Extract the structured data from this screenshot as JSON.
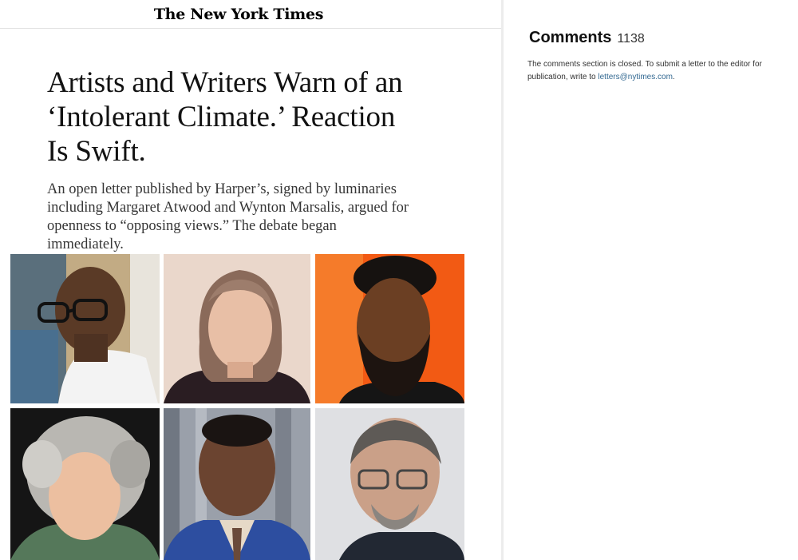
{
  "masthead": {
    "logo_text": "The New York Times"
  },
  "article": {
    "headline": "Artists and Writers Warn of an ‘Intolerant Climate.’ Reaction Is Swift.",
    "summary": "An open letter published by Harper’s, signed by luminaries including Margaret Atwood and Wynton Marsalis, argued for openness to “opposing views.” The debate began immediately.",
    "photos": [
      {
        "icon": "portrait-man-glasses-white-shirt",
        "background": "#c9b48e"
      },
      {
        "icon": "portrait-woman-gray-hair",
        "background": "#e9d5c9"
      },
      {
        "icon": "portrait-man-beard-orange",
        "background": "#f4601c"
      },
      {
        "icon": "portrait-woman-curly-gray-hair",
        "background": "#1b1b1b"
      },
      {
        "icon": "portrait-man-suit-curtain",
        "background": "#8a8f9a"
      },
      {
        "icon": "portrait-man-glasses-gray",
        "background": "#d8dade"
      }
    ]
  },
  "comments": {
    "title": "Comments",
    "count": "1138",
    "note_text": "The comments section is closed. To submit a letter to the editor for publication, write to ",
    "email_link": "letters@nytimes.com",
    "note_end": "."
  },
  "colors": {
    "link": "#326891",
    "divider": "#ececec"
  }
}
